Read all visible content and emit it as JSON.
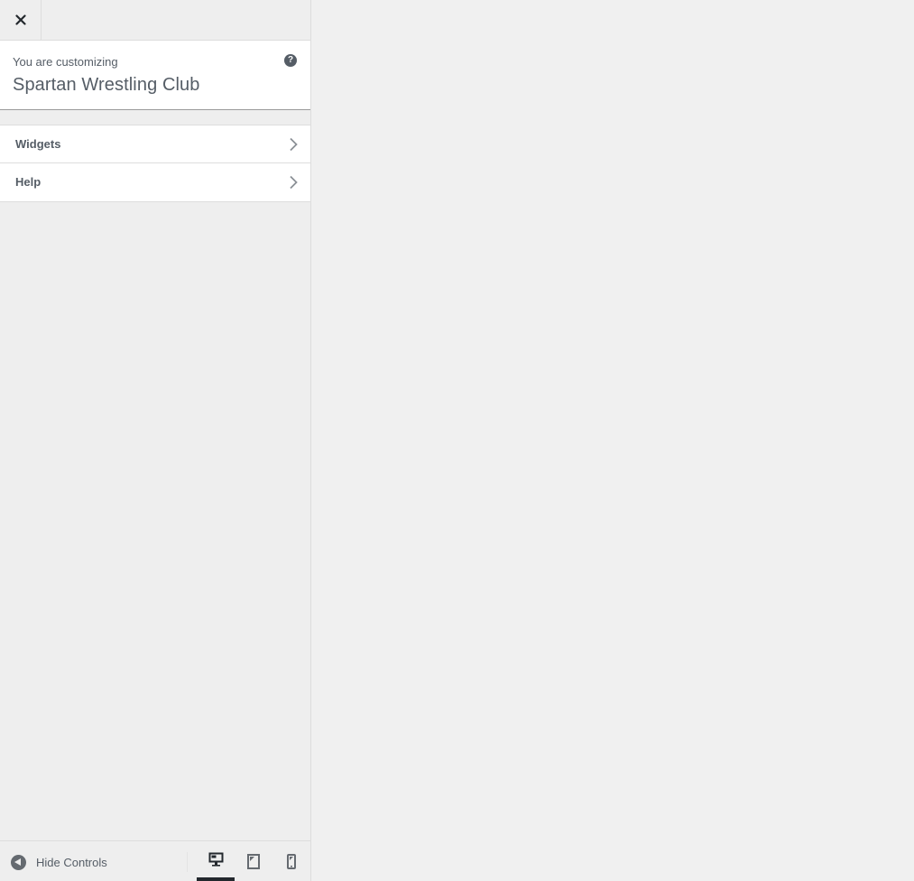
{
  "header": {
    "close_label": "Close"
  },
  "info": {
    "pre_title": "You are customizing",
    "site_title": "Spartan Wrestling Club",
    "help_glyph": "?"
  },
  "sections": [
    {
      "label": "Widgets",
      "icon": "chevron-right-icon"
    },
    {
      "label": "Help",
      "icon": "chevron-right-icon"
    }
  ],
  "footer": {
    "hide_controls_label": "Hide Controls",
    "devices": [
      {
        "name": "desktop",
        "icon": "desktop-icon",
        "active": true
      },
      {
        "name": "tablet",
        "icon": "tablet-icon",
        "active": false
      },
      {
        "name": "mobile",
        "icon": "mobile-icon",
        "active": false
      }
    ]
  },
  "colors": {
    "panel_bg": "#eeeeee",
    "text": "#555d66",
    "active_indicator": "#23282d",
    "preview_bg": "#f0f0f0"
  }
}
